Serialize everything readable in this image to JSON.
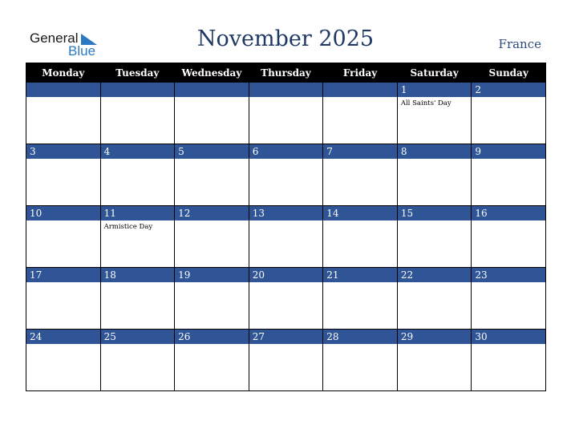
{
  "logo": {
    "line1": "General",
    "line2": "Blue"
  },
  "header": {
    "title": "November 2025",
    "country": "France"
  },
  "colors": {
    "header_bg": "#000000",
    "day_bar": "#2f5597",
    "title": "#1f3864"
  },
  "weekdays": [
    "Monday",
    "Tuesday",
    "Wednesday",
    "Thursday",
    "Friday",
    "Saturday",
    "Sunday"
  ],
  "weeks": [
    [
      {
        "day": "",
        "holiday": ""
      },
      {
        "day": "",
        "holiday": ""
      },
      {
        "day": "",
        "holiday": ""
      },
      {
        "day": "",
        "holiday": ""
      },
      {
        "day": "",
        "holiday": ""
      },
      {
        "day": "1",
        "holiday": "All Saints' Day"
      },
      {
        "day": "2",
        "holiday": ""
      }
    ],
    [
      {
        "day": "3",
        "holiday": ""
      },
      {
        "day": "4",
        "holiday": ""
      },
      {
        "day": "5",
        "holiday": ""
      },
      {
        "day": "6",
        "holiday": ""
      },
      {
        "day": "7",
        "holiday": ""
      },
      {
        "day": "8",
        "holiday": ""
      },
      {
        "day": "9",
        "holiday": ""
      }
    ],
    [
      {
        "day": "10",
        "holiday": ""
      },
      {
        "day": "11",
        "holiday": "Armistice Day"
      },
      {
        "day": "12",
        "holiday": ""
      },
      {
        "day": "13",
        "holiday": ""
      },
      {
        "day": "14",
        "holiday": ""
      },
      {
        "day": "15",
        "holiday": ""
      },
      {
        "day": "16",
        "holiday": ""
      }
    ],
    [
      {
        "day": "17",
        "holiday": ""
      },
      {
        "day": "18",
        "holiday": ""
      },
      {
        "day": "19",
        "holiday": ""
      },
      {
        "day": "20",
        "holiday": ""
      },
      {
        "day": "21",
        "holiday": ""
      },
      {
        "day": "22",
        "holiday": ""
      },
      {
        "day": "23",
        "holiday": ""
      }
    ],
    [
      {
        "day": "24",
        "holiday": ""
      },
      {
        "day": "25",
        "holiday": ""
      },
      {
        "day": "26",
        "holiday": ""
      },
      {
        "day": "27",
        "holiday": ""
      },
      {
        "day": "28",
        "holiday": ""
      },
      {
        "day": "29",
        "holiday": ""
      },
      {
        "day": "30",
        "holiday": ""
      }
    ]
  ]
}
